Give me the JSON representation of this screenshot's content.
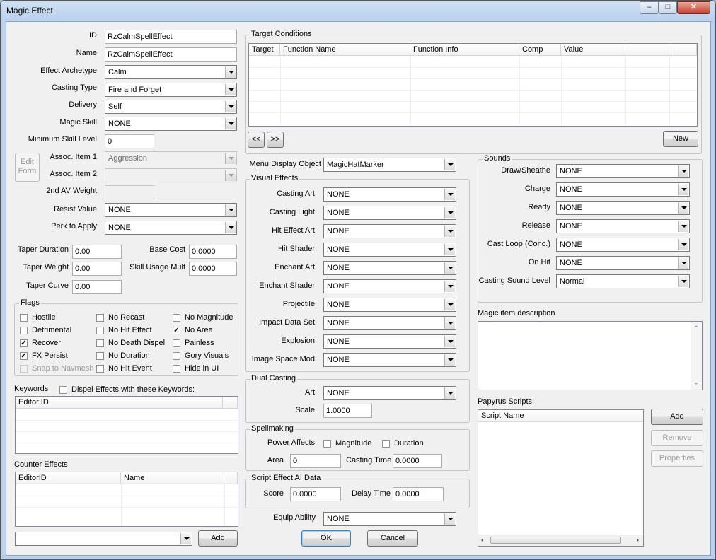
{
  "window": {
    "title": "Magic Effect",
    "controls": [
      "–",
      "□",
      "✕"
    ]
  },
  "left": {
    "id_label": "ID",
    "id_value": "RzCalmSpellEffect",
    "name_label": "Name",
    "name_value": "RzCalmSpellEffect",
    "archetype_label": "Effect Archetype",
    "archetype_value": "Calm",
    "casting_type_label": "Casting Type",
    "casting_type_value": "Fire and Forget",
    "delivery_label": "Delivery",
    "delivery_value": "Self",
    "magic_skill_label": "Magic Skill",
    "magic_skill_value": "NONE",
    "min_skill_label": "Minimum Skill Level",
    "min_skill_value": "0",
    "edit_form_line1": "Edit",
    "edit_form_line2": "Form",
    "assoc1_label": "Assoc. Item 1",
    "assoc1_value": "Aggression",
    "assoc2_label": "Assoc. Item 2",
    "assoc2_value": "",
    "av_weight_label": "2nd AV Weight",
    "av_weight_value": "",
    "resist_label": "Resist Value",
    "resist_value": "NONE",
    "perk_label": "Perk to Apply",
    "perk_value": "NONE",
    "taper_duration_label": "Taper Duration",
    "taper_duration_value": "0.00",
    "taper_weight_label": "Taper Weight",
    "taper_weight_value": "0.00",
    "taper_curve_label": "Taper Curve",
    "taper_curve_value": "0.00",
    "base_cost_label": "Base Cost",
    "base_cost_value": "0.0000",
    "skill_usage_label": "Skill Usage Mult",
    "skill_usage_value": "0.0000"
  },
  "flags": {
    "title": "Flags",
    "items": [
      {
        "label": "Hostile",
        "checked": false,
        "enabled": true
      },
      {
        "label": "Detrimental",
        "checked": false,
        "enabled": true
      },
      {
        "label": "Recover",
        "checked": true,
        "enabled": true
      },
      {
        "label": "FX Persist",
        "checked": true,
        "enabled": true
      },
      {
        "label": "Snap to Navmesh",
        "checked": false,
        "enabled": false
      },
      {
        "label": "No Recast",
        "checked": false,
        "enabled": true
      },
      {
        "label": "No Hit Effect",
        "checked": false,
        "enabled": true
      },
      {
        "label": "No Death Dispel",
        "checked": false,
        "enabled": true
      },
      {
        "label": "No Duration",
        "checked": false,
        "enabled": true
      },
      {
        "label": "No Hit Event",
        "checked": false,
        "enabled": true
      },
      {
        "label": "No Magnitude",
        "checked": false,
        "enabled": true
      },
      {
        "label": "No Area",
        "checked": true,
        "enabled": true
      },
      {
        "label": "Painless",
        "checked": false,
        "enabled": true
      },
      {
        "label": "Gory Visuals",
        "checked": false,
        "enabled": true
      },
      {
        "label": "Hide in UI",
        "checked": false,
        "enabled": true
      }
    ],
    "check_glyph": "✓"
  },
  "keywords": {
    "label": "Keywords",
    "dispel_label": "Dispel Effects with these Keywords:",
    "dispel_checked": false,
    "columns": [
      "Editor ID"
    ]
  },
  "counter_effects": {
    "label": "Counter Effects",
    "columns": [
      "EditorID",
      "Name"
    ],
    "combo_value": "",
    "add_label": "Add"
  },
  "target_conditions": {
    "title": "Target Conditions",
    "columns": [
      "Target",
      "Function Name",
      "Function Info",
      "Comp",
      "Value"
    ],
    "prev_label": "<<",
    "next_label": ">>",
    "new_label": "New"
  },
  "menu_display": {
    "label": "Menu Display Object",
    "value": "MagicHatMarker"
  },
  "visual_effects": {
    "title": "Visual Effects",
    "rows": [
      {
        "label": "Casting Art",
        "value": "NONE"
      },
      {
        "label": "Casting Light",
        "value": "NONE"
      },
      {
        "label": "Hit Effect Art",
        "value": "NONE"
      },
      {
        "label": "Hit Shader",
        "value": "NONE"
      },
      {
        "label": "Enchant Art",
        "value": "NONE"
      },
      {
        "label": "Enchant Shader",
        "value": "NONE"
      },
      {
        "label": "Projectile",
        "value": "NONE"
      },
      {
        "label": "Impact Data Set",
        "value": "NONE"
      },
      {
        "label": "Explosion",
        "value": "NONE"
      },
      {
        "label": "Image Space Mod",
        "value": "NONE"
      }
    ]
  },
  "dual_casting": {
    "title": "Dual Casting",
    "art_label": "Art",
    "art_value": "NONE",
    "scale_label": "Scale",
    "scale_value": "1.0000"
  },
  "spellmaking": {
    "title": "Spellmaking",
    "power_label": "Power Affects",
    "magnitude_label": "Magnitude",
    "magnitude_checked": false,
    "duration_label": "Duration",
    "duration_checked": false,
    "area_label": "Area",
    "area_value": "0",
    "casting_time_label": "Casting Time",
    "casting_time_value": "0.0000"
  },
  "script_ai": {
    "title": "Script Effect AI Data",
    "score_label": "Score",
    "score_value": "0.0000",
    "delay_label": "Delay Time",
    "delay_value": "0.0000"
  },
  "equip": {
    "label": "Equip Ability",
    "value": "NONE"
  },
  "dialog_buttons": {
    "ok": "OK",
    "cancel": "Cancel"
  },
  "sounds": {
    "title": "Sounds",
    "rows": [
      {
        "label": "Draw/Sheathe",
        "value": "NONE"
      },
      {
        "label": "Charge",
        "value": "NONE"
      },
      {
        "label": "Ready",
        "value": "NONE"
      },
      {
        "label": "Release",
        "value": "NONE"
      },
      {
        "label": "Cast Loop (Conc.)",
        "value": "NONE"
      },
      {
        "label": "On Hit",
        "value": "NONE"
      },
      {
        "label": "Casting Sound Level",
        "value": "Normal"
      }
    ]
  },
  "description": {
    "label": "Magic item description",
    "value": ""
  },
  "papyrus": {
    "label": "Papyrus Scripts:",
    "column": "Script Name",
    "add_label": "Add",
    "remove_label": "Remove",
    "properties_label": "Properties"
  }
}
